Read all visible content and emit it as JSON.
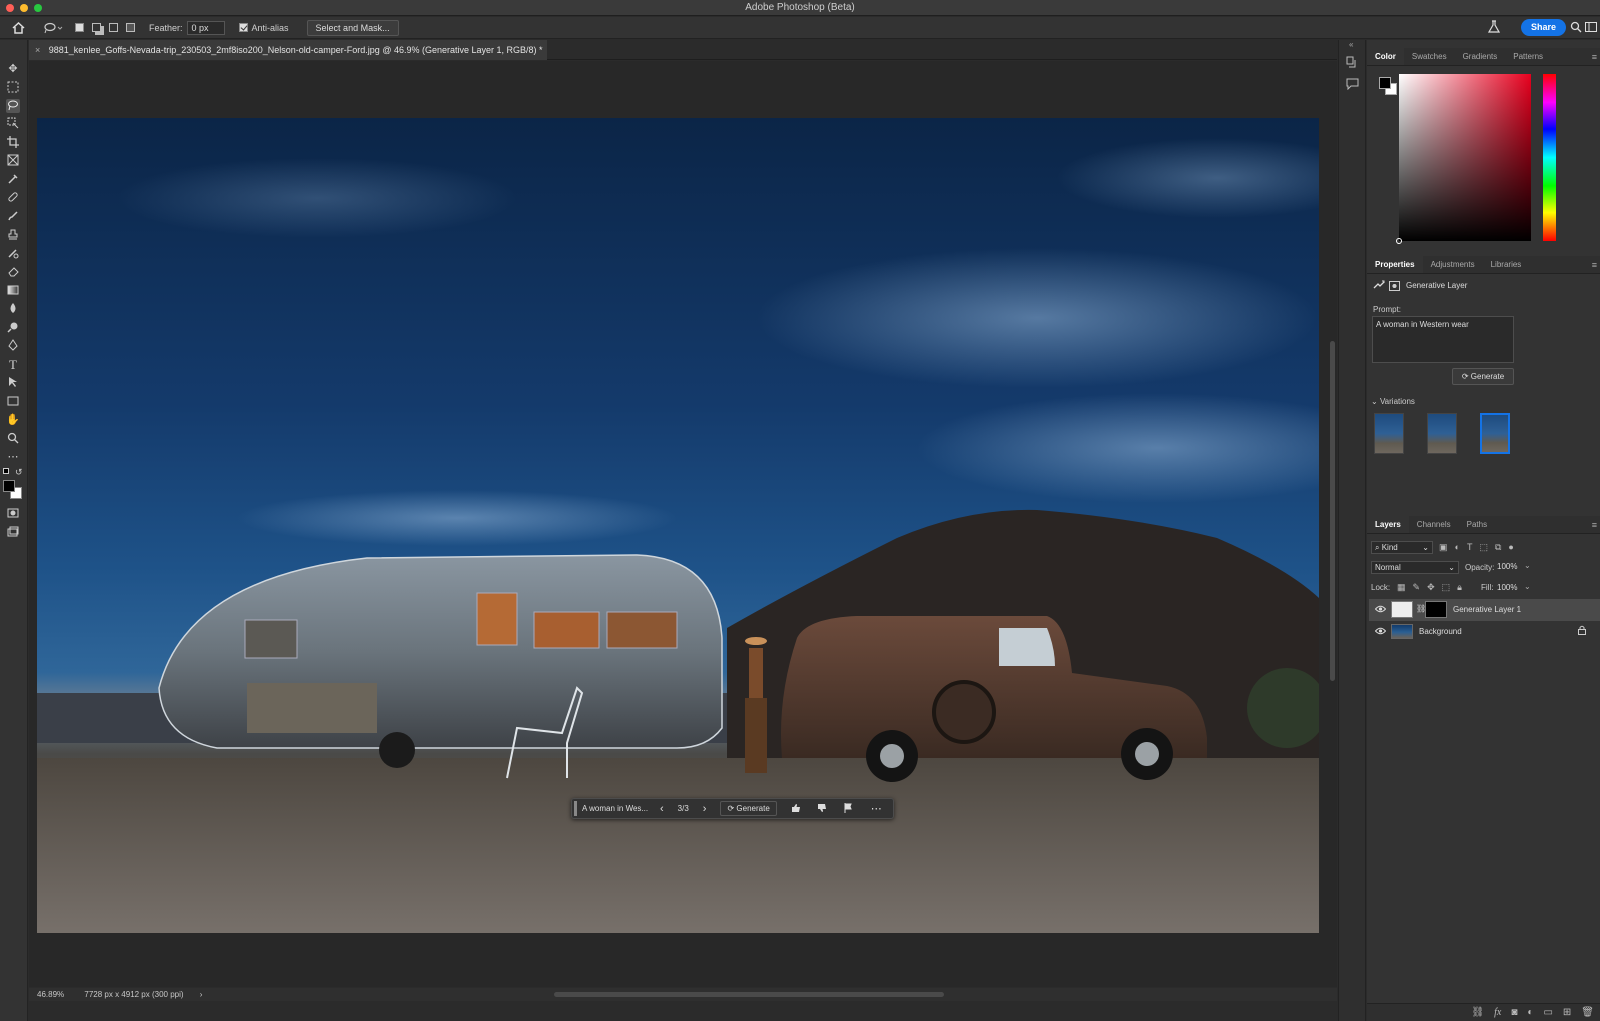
{
  "app": {
    "window_title": "Adobe Photoshop (Beta)"
  },
  "options_bar": {
    "feather_label": "Feather:",
    "feather_value": "0 px",
    "antialias_label": "Anti-alias",
    "select_mask_label": "Select and Mask...",
    "share_label": "Share"
  },
  "document": {
    "tab_title": "9881_kenlee_Goffs-Nevada-trip_230503_2mf8iso200_Nelson-old-camper-Ford.jpg @ 46.9% (Generative Layer 1, RGB/8) *"
  },
  "context_bar": {
    "prompt_text": "A woman in Wes...",
    "counter": "3/3",
    "generate_label": "Generate"
  },
  "status_bar": {
    "zoom": "46.89%",
    "doc_info": "7728 px x 4912 px (300 ppi)"
  },
  "color_panel": {
    "tabs": [
      "Color",
      "Swatches",
      "Gradients",
      "Patterns"
    ]
  },
  "properties_panel": {
    "tabs": [
      "Properties",
      "Adjustments",
      "Libraries"
    ],
    "layer_type": "Generative Layer",
    "prompt_label": "Prompt:",
    "prompt_value": "A woman in Western wear",
    "generate_label": "Generate",
    "variations_label": "Variations"
  },
  "layers_panel": {
    "tabs": [
      "Layers",
      "Channels",
      "Paths"
    ],
    "kind_filter": "Kind",
    "blend_mode": "Normal",
    "opacity_label": "Opacity:",
    "opacity_value": "100%",
    "lock_label": "Lock:",
    "fill_label": "Fill:",
    "fill_value": "100%",
    "layers": [
      {
        "name": "Generative Layer 1"
      },
      {
        "name": "Background"
      }
    ]
  }
}
